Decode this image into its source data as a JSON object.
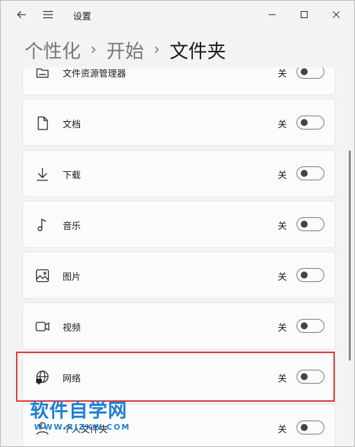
{
  "window": {
    "title": "设置",
    "buttons": {
      "back": "back-arrow-icon",
      "menu": "hamburger-icon",
      "minimize": "minimize-icon",
      "maximize": "maximize-icon",
      "close": "close-icon"
    }
  },
  "breadcrumb": {
    "items": [
      "个性化",
      "开始",
      "文件夹"
    ],
    "separator": "›"
  },
  "folders": [
    {
      "label": "文件资源管理器",
      "state": "关",
      "icon": "file-explorer-icon",
      "on": false
    },
    {
      "label": "文档",
      "state": "关",
      "icon": "document-icon",
      "on": false
    },
    {
      "label": "下载",
      "state": "关",
      "icon": "download-icon",
      "on": false
    },
    {
      "label": "音乐",
      "state": "关",
      "icon": "music-note-icon",
      "on": false
    },
    {
      "label": "图片",
      "state": "关",
      "icon": "picture-icon",
      "on": false
    },
    {
      "label": "视频",
      "state": "关",
      "icon": "video-icon",
      "on": false
    },
    {
      "label": "网络",
      "state": "关",
      "icon": "network-globe-icon",
      "on": false
    },
    {
      "label": "个人文件夹",
      "state": "关",
      "icon": "personal-folder-icon",
      "on": false
    }
  ],
  "watermark": {
    "main": "软件自学网",
    "sub": "WWW.RJZXW.COM"
  },
  "colors": {
    "highlight": "#e03535",
    "watermark": "#1e7fd6",
    "background": "#f3f3f3"
  }
}
